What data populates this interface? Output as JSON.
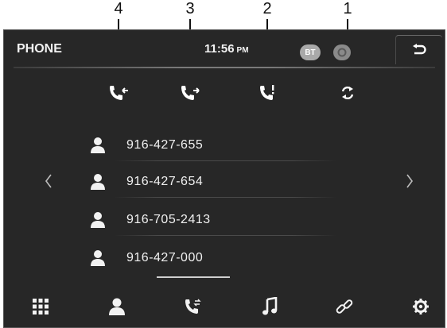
{
  "callouts": [
    "4",
    "3",
    "2",
    "1"
  ],
  "status_bar": {
    "title": "PHONE",
    "time": "11:56",
    "ampm": "PM",
    "bt_label": "BT"
  },
  "tabs": [
    {
      "icon": "incoming-call-icon"
    },
    {
      "icon": "outgoing-call-icon"
    },
    {
      "icon": "missed-call-icon"
    },
    {
      "icon": "sync-icon"
    }
  ],
  "contacts": [
    {
      "number": "916-427-655"
    },
    {
      "number": "916-427-654"
    },
    {
      "number": "916-705-2413"
    },
    {
      "number": "916-427-000"
    }
  ],
  "bottom_nav": [
    {
      "icon": "keypad-icon"
    },
    {
      "icon": "contacts-icon"
    },
    {
      "icon": "call-log-icon"
    },
    {
      "icon": "music-icon"
    },
    {
      "icon": "link-icon"
    },
    {
      "icon": "settings-icon"
    }
  ],
  "colors": {
    "screen_bg": "#272727",
    "text": "#f0f0f0",
    "bt_badge": "#a9a9a9"
  }
}
